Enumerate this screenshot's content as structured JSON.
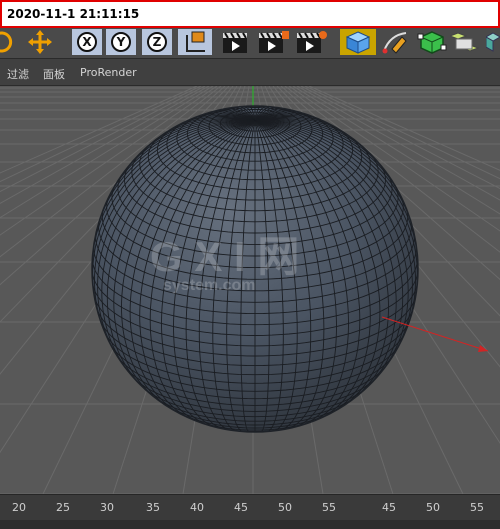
{
  "banner": {
    "timestamp": "2020-11-1 21:11:15"
  },
  "toolbar": {
    "axis_x": "X",
    "axis_y": "Y",
    "axis_z": "Z",
    "icons": [
      "rotate-icon",
      "move-icon",
      "x-axis-lock",
      "y-axis-lock",
      "z-axis-lock",
      "coordinate-system-icon",
      "render-view-icon",
      "render-picture-viewer-icon",
      "render-settings-icon",
      "cube-primitive-icon",
      "pen-spline-icon",
      "subdivision-icon",
      "array-icon",
      "more-icon"
    ]
  },
  "menu": {
    "filter": "过滤",
    "panel": "面板",
    "prorender": "ProRender"
  },
  "viewport": {
    "object": "sphere",
    "watermark_top": "G X I 网",
    "watermark_bottom": "system.com",
    "colors": {
      "background": "#585858",
      "grid": "#6a6a6a",
      "sphere": "#4e5866",
      "wire": "#1a1d22",
      "x_axis": "#d22424",
      "y_axis": "#20c020"
    }
  },
  "timeline": {
    "ticks": [
      "20",
      "25",
      "30",
      "35",
      "40",
      "45",
      "50",
      "55",
      "45",
      "50",
      "55"
    ]
  }
}
